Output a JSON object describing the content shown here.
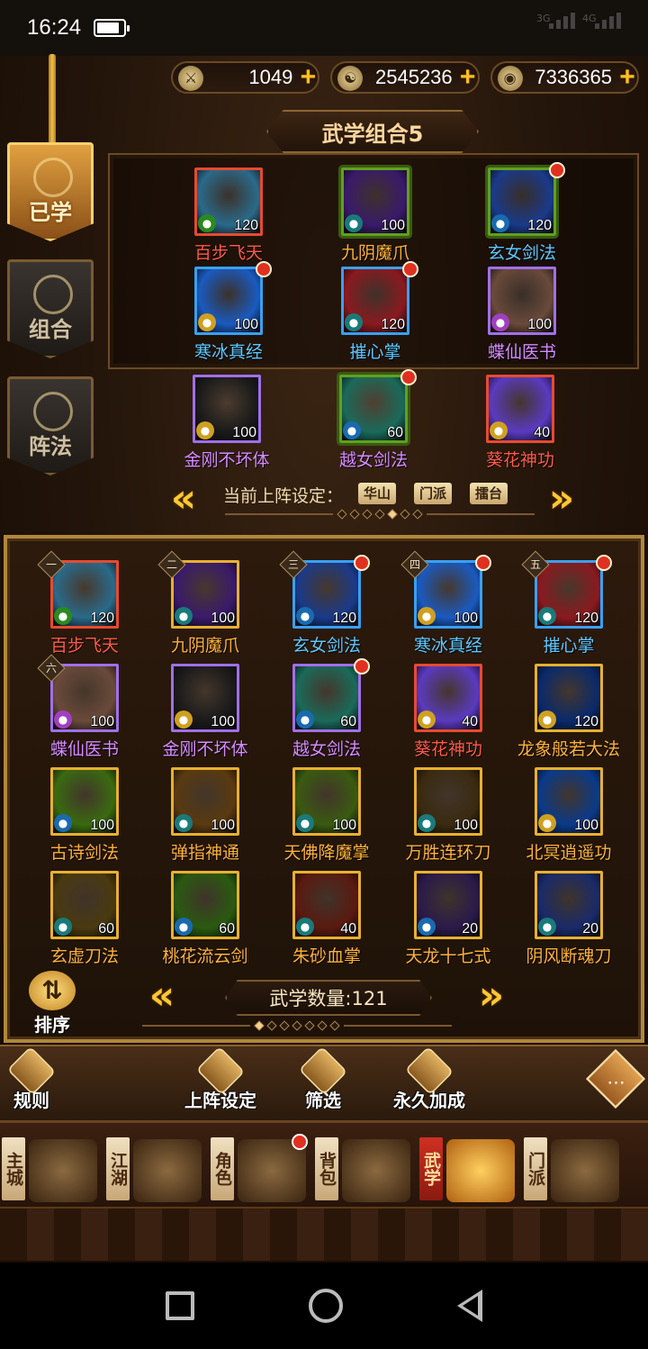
{
  "status": {
    "time": "16:24",
    "net1": "3G",
    "net2": "4G"
  },
  "resources": [
    {
      "icon": "sword-token-icon",
      "value": "1049"
    },
    {
      "icon": "yin-yang-coin-icon",
      "value": "2545236"
    },
    {
      "icon": "silver-coin-icon",
      "value": "7336365"
    }
  ],
  "sidetabs": [
    {
      "label": "已学",
      "active": true
    },
    {
      "label": "组合",
      "active": false
    },
    {
      "label": "阵法",
      "active": false
    }
  ],
  "combo_title": "武学组合5",
  "combo_skills": [
    {
      "name": "百步飞天",
      "level": "120",
      "color": "red",
      "badge": "green",
      "dot": false,
      "frame": "red",
      "art": "#2a6a8a"
    },
    {
      "name": "九阴魔爪",
      "level": "100",
      "color": "orange",
      "badge": "teal",
      "dot": false,
      "frame": "green",
      "art": "#3a1a6a"
    },
    {
      "name": "玄女剑法",
      "level": "120",
      "color": "blue",
      "badge": "blue",
      "dot": true,
      "frame": "green",
      "art": "#1a3a8a"
    },
    {
      "name": "寒冰真经",
      "level": "100",
      "color": "blue",
      "badge": "gold",
      "dot": true,
      "frame": "blue",
      "art": "#1a5ac0"
    },
    {
      "name": "摧心掌",
      "level": "120",
      "color": "blue",
      "badge": "teal",
      "dot": true,
      "frame": "blue",
      "art": "#8a1a20"
    },
    {
      "name": "蝶仙医书",
      "level": "100",
      "color": "purple",
      "badge": "purple",
      "dot": false,
      "frame": "purple",
      "art": "#6a4a3a"
    },
    {
      "name": "金刚不坏体",
      "level": "100",
      "color": "purple",
      "badge": "gold",
      "dot": false,
      "frame": "purple",
      "art": "#1a1a1a"
    },
    {
      "name": "越女剑法",
      "level": "60",
      "color": "purple",
      "badge": "blue",
      "dot": true,
      "frame": "green",
      "art": "#1a6a5a"
    },
    {
      "name": "葵花神功",
      "level": "40",
      "color": "red",
      "badge": "gold",
      "dot": false,
      "frame": "red",
      "art": "#5a3ac0"
    }
  ],
  "lineup": {
    "label": "当前上阵设定：",
    "tags": [
      "华山",
      "门派",
      "擂台"
    ]
  },
  "skills": [
    {
      "rank": "一",
      "name": "百步飞天",
      "level": "120",
      "color": "red",
      "badge": "green",
      "dot": false,
      "frame": "red",
      "art": "#2a6a8a"
    },
    {
      "rank": "二",
      "name": "九阴魔爪",
      "level": "100",
      "color": "orange",
      "badge": "teal",
      "dot": false,
      "frame": "orange",
      "art": "#3a1a6a"
    },
    {
      "rank": "三",
      "name": "玄女剑法",
      "level": "120",
      "color": "blue",
      "badge": "blue",
      "dot": true,
      "frame": "blue",
      "art": "#1a3a8a"
    },
    {
      "rank": "四",
      "name": "寒冰真经",
      "level": "100",
      "color": "blue",
      "badge": "gold",
      "dot": true,
      "frame": "blue",
      "art": "#1a5ac0"
    },
    {
      "rank": "五",
      "name": "摧心掌",
      "level": "120",
      "color": "blue",
      "badge": "teal",
      "dot": true,
      "frame": "blue",
      "art": "#8a1a20"
    },
    {
      "rank": "六",
      "name": "蝶仙医书",
      "level": "100",
      "color": "purple",
      "badge": "purple",
      "dot": false,
      "frame": "purple",
      "art": "#6a4a3a"
    },
    {
      "rank": "",
      "name": "金刚不坏体",
      "level": "100",
      "color": "purple",
      "badge": "gold",
      "dot": false,
      "frame": "purple",
      "art": "#1a1a1a"
    },
    {
      "rank": "",
      "name": "越女剑法",
      "level": "60",
      "color": "purple",
      "badge": "blue",
      "dot": true,
      "frame": "purple",
      "art": "#1a6a5a"
    },
    {
      "rank": "",
      "name": "葵花神功",
      "level": "40",
      "color": "red",
      "badge": "gold",
      "dot": false,
      "frame": "red",
      "art": "#5a3ac0"
    },
    {
      "rank": "",
      "name": "龙象般若大法",
      "level": "120",
      "color": "orange",
      "badge": "gold",
      "dot": false,
      "frame": "orange",
      "art": "#0a2a6a"
    },
    {
      "rank": "",
      "name": "古诗剑法",
      "level": "100",
      "color": "orange",
      "badge": "blue",
      "dot": false,
      "frame": "orange",
      "art": "#3a6a10"
    },
    {
      "rank": "",
      "name": "弹指神通",
      "level": "100",
      "color": "orange",
      "badge": "teal",
      "dot": false,
      "frame": "orange",
      "art": "#5a3a10"
    },
    {
      "rank": "",
      "name": "天佛降魔掌",
      "level": "100",
      "color": "orange",
      "badge": "teal",
      "dot": false,
      "frame": "orange",
      "art": "#3a5a10"
    },
    {
      "rank": "",
      "name": "万胜连环刀",
      "level": "100",
      "color": "orange",
      "badge": "teal",
      "dot": false,
      "frame": "orange",
      "art": "#3a2a10"
    },
    {
      "rank": "",
      "name": "北冥逍遥功",
      "level": "100",
      "color": "orange",
      "badge": "gold",
      "dot": false,
      "frame": "orange",
      "art": "#0a3a8a"
    },
    {
      "rank": "",
      "name": "玄虚刀法",
      "level": "60",
      "color": "orange",
      "badge": "teal",
      "dot": false,
      "frame": "orange",
      "art": "#4a3a10"
    },
    {
      "rank": "",
      "name": "桃花流云剑",
      "level": "60",
      "color": "orange",
      "badge": "blue",
      "dot": false,
      "frame": "orange",
      "art": "#2a5a10"
    },
    {
      "rank": "",
      "name": "朱砂血掌",
      "level": "40",
      "color": "orange",
      "badge": "teal",
      "dot": false,
      "frame": "orange",
      "art": "#5a1a10"
    },
    {
      "rank": "",
      "name": "天龙十七式",
      "level": "20",
      "color": "orange",
      "badge": "blue",
      "dot": false,
      "frame": "orange",
      "art": "#2a1a4a"
    },
    {
      "rank": "",
      "name": "阴风断魂刀",
      "level": "20",
      "color": "orange",
      "badge": "teal",
      "dot": false,
      "frame": "orange",
      "art": "#1a2a6a"
    }
  ],
  "sort_label": "排序",
  "count_label": "武学数量:121",
  "toolbar": [
    {
      "label": "规则",
      "icon": "rules-scroll-icon"
    },
    {
      "label": "上阵设定",
      "icon": "lineup-icon"
    },
    {
      "label": "筛选",
      "icon": "filter-icon"
    },
    {
      "label": "永久加成",
      "icon": "bonus-icon"
    }
  ],
  "chat_icon": "chat-icon",
  "mainnav": [
    {
      "label": "主城",
      "active": false,
      "dot": false
    },
    {
      "label": "江湖",
      "active": false,
      "dot": false
    },
    {
      "label": "角色",
      "active": false,
      "dot": true
    },
    {
      "label": "背包",
      "active": false,
      "dot": false
    },
    {
      "label": "武学",
      "active": true,
      "dot": false
    },
    {
      "label": "门派",
      "active": false,
      "dot": false
    }
  ]
}
